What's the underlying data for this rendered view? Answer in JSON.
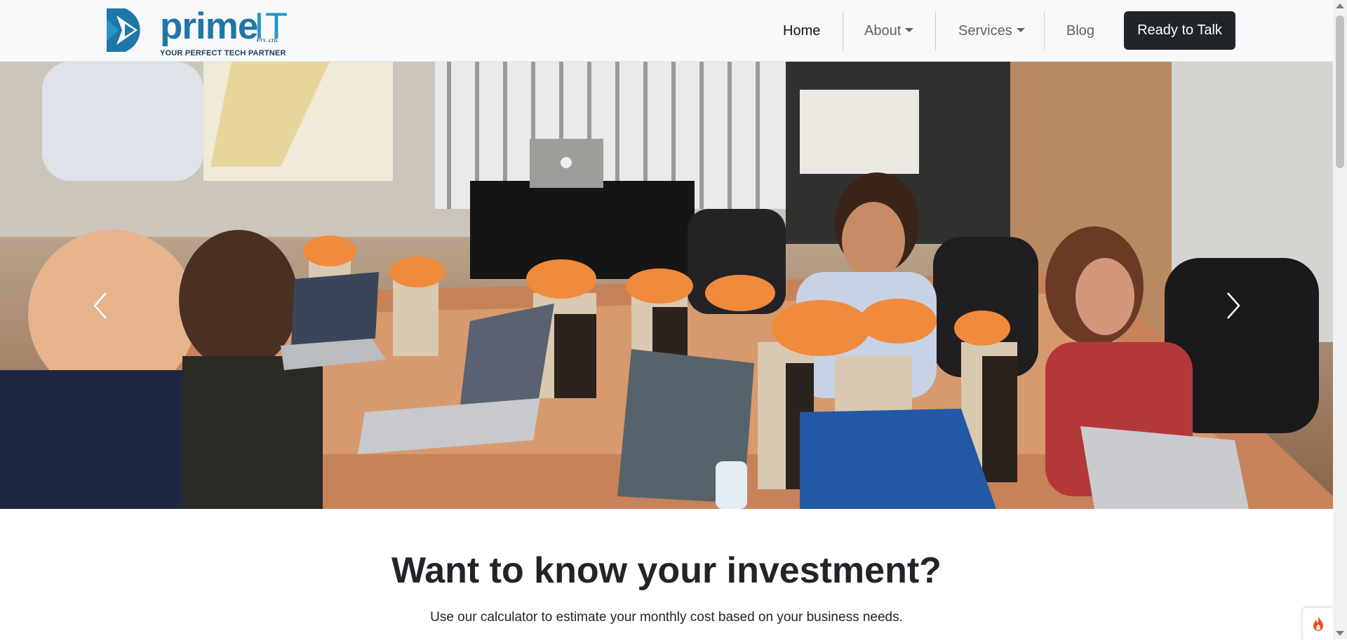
{
  "brand": {
    "name_primary": "prime",
    "name_secondary": "IT",
    "entity_suffix": "PTY. LTD.",
    "tagline": "YOUR PERFECT TECH PARTNER",
    "logo_icon": "arrow-d-logo-mark",
    "colors": {
      "primary": "#1f76a9",
      "accent": "#2695c9",
      "dark": "#173f60"
    }
  },
  "nav": {
    "items": [
      {
        "label": "Home",
        "active": true,
        "dropdown": false
      },
      {
        "label": "About",
        "active": false,
        "dropdown": true
      },
      {
        "label": "Services",
        "active": false,
        "dropdown": true
      },
      {
        "label": "Blog",
        "active": false,
        "dropdown": false
      }
    ],
    "cta_label": "Ready to Talk",
    "cta_color": "#212529",
    "background": "#f8f9fa"
  },
  "carousel": {
    "image_subject": "team meeting around conference table with laptops and gift bags",
    "prev_icon": "chevron-left-icon",
    "next_icon": "chevron-right-icon"
  },
  "section": {
    "title": "Want to know your investment?",
    "text": "Use our calculator to estimate your monthly cost based on your business needs."
  },
  "widget": {
    "icon": "flame-icon",
    "color": "#e8501e"
  }
}
